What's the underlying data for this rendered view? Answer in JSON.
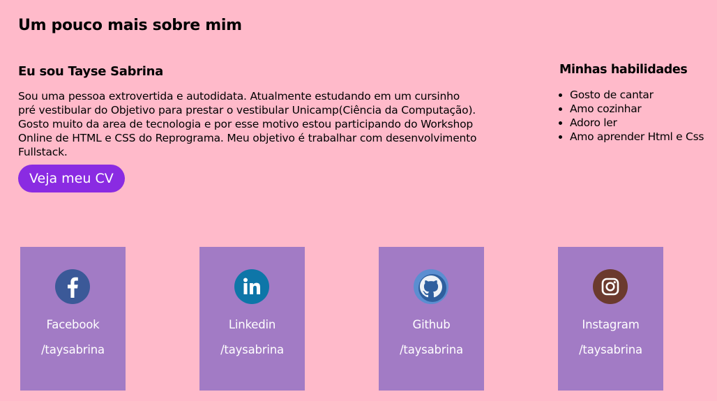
{
  "section_title": "Um pouco mais sobre mim",
  "about": {
    "heading": "Eu sou Tayse Sabrina",
    "line1": "Sou uma pessoa extrovertida e autodidata. Atualmente estudando em um cursinho",
    "line2": "pré vestibular do Objetivo para prestar o vestibular Unicamp(Ciência da Computação).",
    "line3": "Gosto muito da area de tecnologia e por esse motivo estou participando do Workshop",
    "line4": "Online de HTML e CSS do Reprograma. Meu objetivo é trabalhar com desenvolvimento",
    "line5": "Fullstack.",
    "cv_button": "Veja meu CV"
  },
  "skills": {
    "heading": "Minhas habilidades",
    "items": [
      "Gosto de cantar",
      "Amo cozinhar",
      "Adoro ler",
      "Amo aprender Html e Css"
    ]
  },
  "social": [
    {
      "name": "Facebook",
      "handle": "/taysabrina",
      "icon": "facebook-icon",
      "color": "#3b5998"
    },
    {
      "name": "Linkedin",
      "handle": "/taysabrina",
      "icon": "linkedin-icon",
      "color": "#0e76a8"
    },
    {
      "name": "Github",
      "handle": "/taysabrina",
      "icon": "github-icon",
      "color": "#4a7fc1"
    },
    {
      "name": "Instagram",
      "handle": "/taysabrina",
      "icon": "instagram-icon",
      "color": "#6b3a2e"
    }
  ],
  "colors": {
    "background": "#ffbaca",
    "button": "#8a2be2",
    "card": "#a27bc5"
  }
}
